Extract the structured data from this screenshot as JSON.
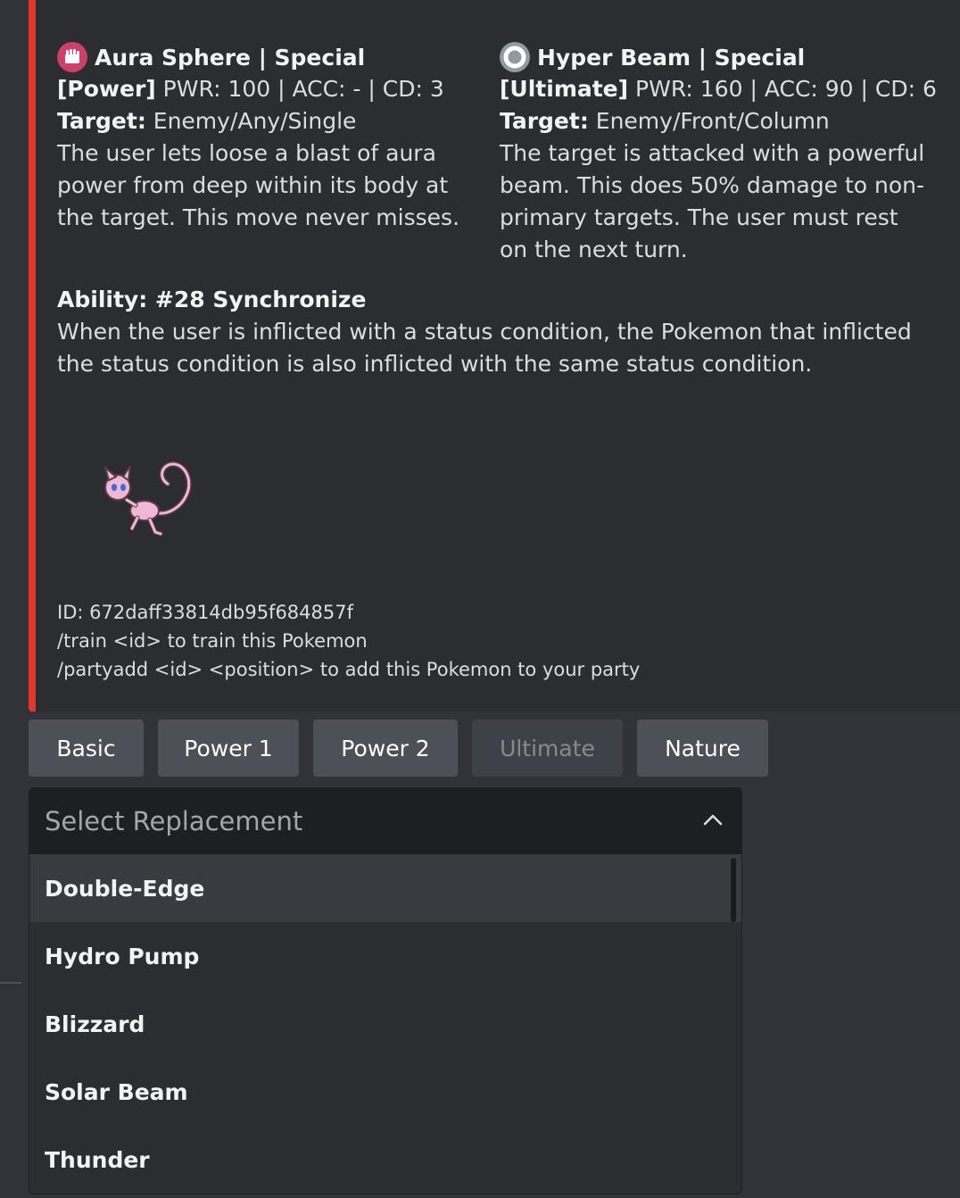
{
  "moves": [
    {
      "title": "Aura Sphere | Special",
      "type_icon": "fighting-type-icon",
      "tag": "[Power]",
      "stats": " PWR: 100 | ACC: - | CD: 3",
      "target_label": "Target:",
      "target": " Enemy/Any/Single",
      "description": "The user lets loose a blast of aura power from deep within its body at the target. This move never misses."
    },
    {
      "title": "Hyper Beam | Special",
      "type_icon": "normal-type-icon",
      "tag": "[Ultimate]",
      "stats": " PWR: 160 | ACC: 90 | CD: 6",
      "target_label": "Target:",
      "target": " Enemy/Front/Column",
      "description": "The target is attacked with a powerful beam. This does 50% damage to non-primary targets. The user must rest on the next turn."
    }
  ],
  "ability": {
    "title": "Ability: #28 Synchronize",
    "description": "When the user is inflicted with a status condition, the Pokemon that inflicted the status condition is also inflicted with the same status condition."
  },
  "footer": {
    "id_line": "ID: 672daff33814db95f684857f",
    "train_line": "/train <id> to train this Pokemon",
    "party_line": "/partyadd <id> <position> to add this Pokemon to your party"
  },
  "buttons": [
    "Basic",
    "Power 1",
    "Power 2",
    "Ultimate",
    "Nature"
  ],
  "select": {
    "placeholder": "Select Replacement",
    "options": [
      "Double-Edge",
      "Hydro Pump",
      "Blizzard",
      "Solar Beam",
      "Thunder"
    ]
  },
  "colors": {
    "embed_accent": "#e3372a",
    "fighting": "#ce4069",
    "normal": "#919aa2"
  }
}
